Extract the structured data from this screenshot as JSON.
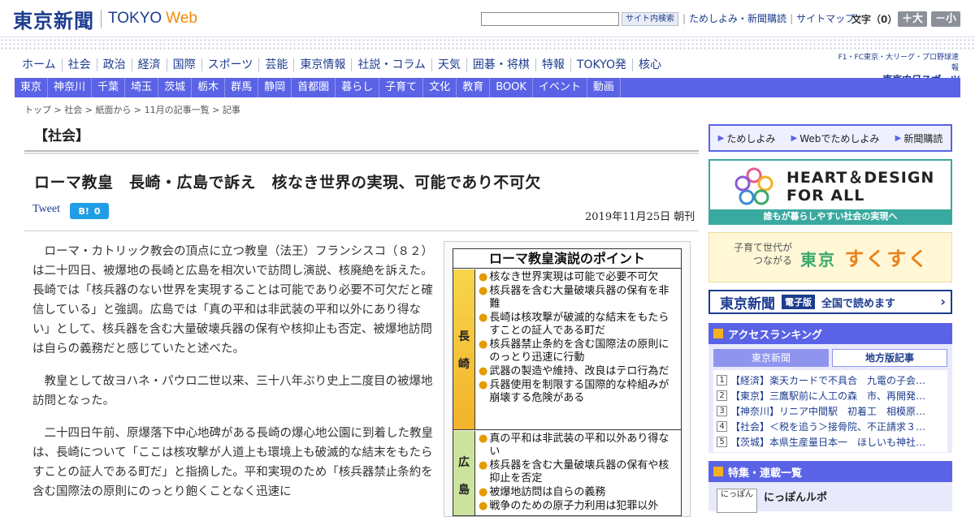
{
  "header": {
    "logo_jp": "東京新聞",
    "logo_en": "TOKYO",
    "logo_web": "Web",
    "search_button": "サイト内検索",
    "links": [
      "ためしよみ・新聞購読",
      "サイトマップ"
    ],
    "font_label": "文字（0）",
    "font_larger": "＋大",
    "font_smaller": "－小"
  },
  "main_nav": [
    "ホーム",
    "社会",
    "政治",
    "経済",
    "国際",
    "スポーツ",
    "芸能",
    "東京情報",
    "社説・コラム",
    "天気",
    "囲碁・将棋",
    "特報",
    "TOKYO発",
    "核心"
  ],
  "chunichi": {
    "line1": "F1・FC東京・大リーグ・プロ野球速報",
    "line2": "東京中日スポーツ"
  },
  "sub_nav": [
    "東京",
    "神奈川",
    "千葉",
    "埼玉",
    "茨城",
    "栃木",
    "群馬",
    "静岡",
    "首都圏",
    "暮らし",
    "子育て",
    "文化",
    "教育",
    "BOOK",
    "イベント",
    "動画"
  ],
  "breadcrumb": [
    "トップ",
    "社会",
    "紙面から",
    "11月の記事一覧",
    "記事"
  ],
  "article": {
    "section": "【社会】",
    "headline": "ローマ教皇　長崎・広島で訴え　核なき世界の実現、可能であり不可欠",
    "tweet": "Tweet",
    "hatena_label": "B!",
    "hatena_count": "0",
    "date": "2019年11月25日 朝刊",
    "paragraphs": [
      "ローマ・カトリック教会の頂点に立つ教皇（法王）フランシスコ（８２）は二十四日、被爆地の長崎と広島を相次いで訪問し演説、核廃絶を訴えた。長崎では「核兵器のない世界を実現することは可能であり必要不可欠だと確信している」と強調。広島では「真の平和は非武装の平和以外にあり得ない」として、核兵器を含む大量破壊兵器の保有や核抑止も否定、被爆地訪問は自らの義務だと感じていたと述べた。",
      "教皇として故ヨハネ・パウロ二世以来、三十八年ぶり史上二度目の被爆地訪問となった。",
      "二十四日午前、原爆落下中心地碑がある長崎の爆心地公園に到着した教皇は、長崎について「ここは核攻撃が人道上も環境上も破滅的な結末をもたらすことの証人である町だ」と指摘した。平和実現のため「核兵器禁止条約を含む国際法の原則にのっとり飽くことなく迅速に"
    ]
  },
  "figure": {
    "title": "ローマ教皇演説のポイント",
    "nagasaki_label": [
      "長",
      "崎"
    ],
    "nagasaki_items": [
      "核なき世界実現は可能で必要不可欠",
      "核兵器を含む大量破壊兵器の保有を非難",
      "長崎は核攻撃が破滅的な結末をもたらすことの証人である町だ",
      "核兵器禁止条約を含む国際法の原則にのっとり迅速に行動",
      "武器の製造や維持、改良はテロ行為だ",
      "兵器使用を制限する国際的な枠組みが崩壊する危険がある"
    ],
    "hiroshima_label": [
      "広",
      "島"
    ],
    "hiroshima_items": [
      "真の平和は非武装の平和以外あり得ない",
      "核兵器を含む大量破壊兵器の保有や核抑止を否定",
      "被爆地訪問は自らの義務",
      "戦争のための原子力利用は犯罪以外"
    ]
  },
  "sidebar": {
    "tame": [
      "ためしよみ",
      "Webでためしよみ",
      "新聞購読"
    ],
    "heart_title_1": "HEART＆DESIGN",
    "heart_title_2": "FOR ALL",
    "heart_sub": "誰もが暮らしやすい社会の実現へ",
    "suku_small_1": "子育て世代が",
    "suku_small_2": "つながる",
    "suku_tokyo": "東京",
    "suku_big": "すくすく",
    "denshi_logo": "東京新聞",
    "denshi_tag": "電子版",
    "denshi_text": "全国で読めます",
    "ranking_title": "アクセスランキング",
    "ranking_tab1": "東京新聞",
    "ranking_tab2": "地方版記事",
    "ranking_items": [
      "【経済】楽天カードで不具合　九電の子会…",
      "【東京】三鷹駅前に人工の森　市、再開発…",
      "【神奈川】リニア中間駅　初着工　相模原…",
      "【社会】＜税を追う＞接骨院、不正請求３…",
      "【茨城】本県生産量日本一　ほしいも神社…"
    ],
    "feature_title": "特集・連載一覧",
    "feature_item": "にっぽんルポ",
    "feature_thumb": "にっぽん"
  }
}
